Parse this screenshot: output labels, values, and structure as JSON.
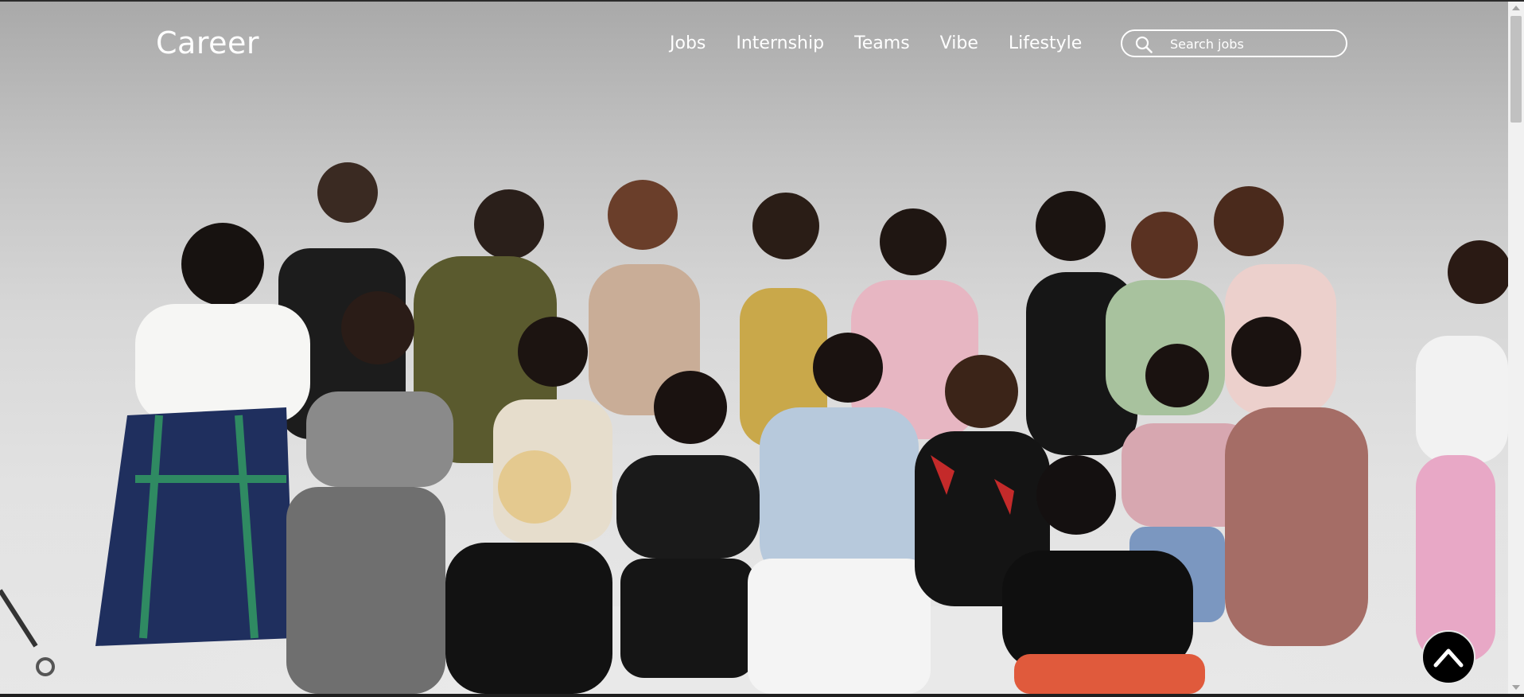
{
  "header": {
    "logo": "Career",
    "nav": [
      {
        "label": "Jobs"
      },
      {
        "label": "Internship"
      },
      {
        "label": "Teams"
      },
      {
        "label": "Vibe"
      },
      {
        "label": "Lifestyle"
      }
    ],
    "search": {
      "placeholder": "Search jobs",
      "value": "",
      "icon": "search-icon"
    }
  },
  "hero": {
    "image": "group-photo-of-team"
  },
  "scroll_top": {
    "icon": "chevron-up-icon"
  },
  "colors": {
    "text": "#ffffff",
    "scroll_button": "#000000",
    "background": "#e2e2e2"
  }
}
